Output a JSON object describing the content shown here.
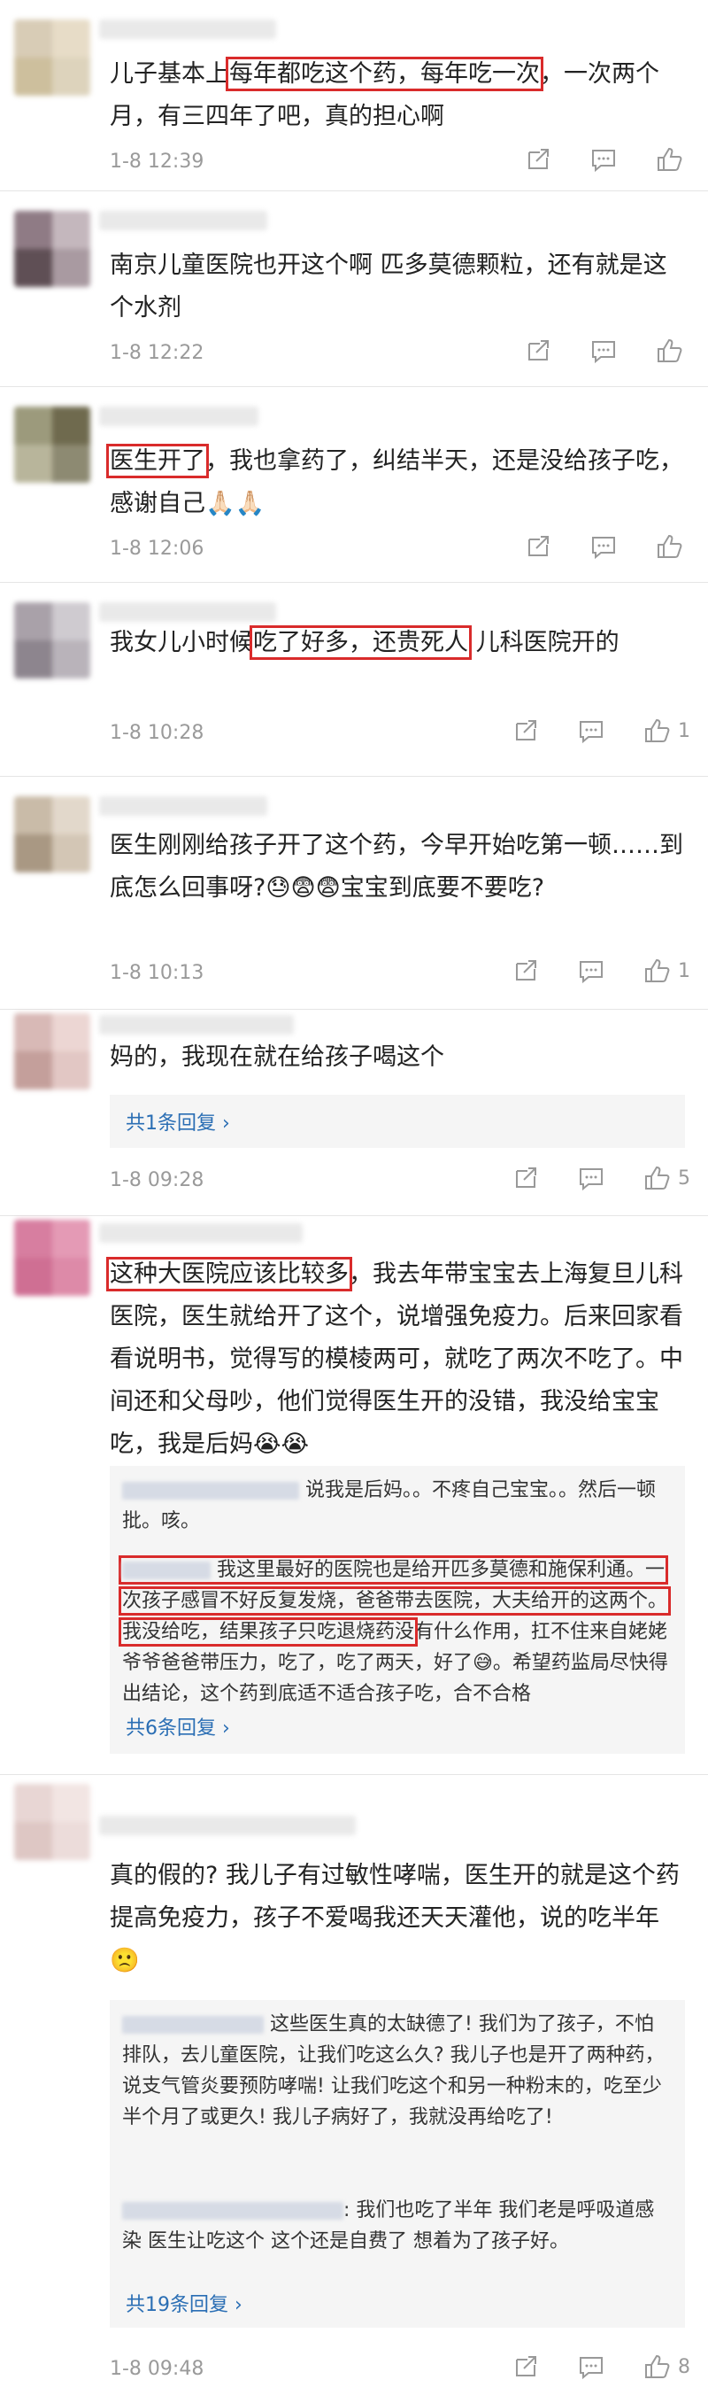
{
  "comments": [
    {
      "text_pre": "儿子基本上",
      "text_hl": "每年都吃这个药，每年吃一次",
      "text_post": "，一次两个月，有三四年了吧，真的担心啊",
      "time": "1-8 12:39",
      "likes": ""
    },
    {
      "text": "南京儿童医院也开这个啊 匹多莫德颗粒，还有就是这个水剂",
      "time": "1-8 12:22",
      "likes": ""
    },
    {
      "text_hl": "医生开了",
      "text_post": "，我也拿药了，纠结半天，还是没给孩子吃，感谢自己🙏🏻🙏🏻",
      "time": "1-8 12:06",
      "likes": ""
    },
    {
      "text_pre": "我女儿小时候",
      "text_hl": "吃了好多，还贵死人",
      "text_post": " 儿科医院开的",
      "time": "1-8 10:28",
      "likes": "1"
    },
    {
      "text": "医生刚刚给孩子开了这个药，今早开始吃第一顿……到底怎么回事呀?😓😨😨宝宝到底要不要吃?",
      "time": "1-8 10:13",
      "likes": "1"
    },
    {
      "text": "妈的，我现在就在给孩子喝这个",
      "reply_link": "共1条回复 ›",
      "time": "1-8 09:28",
      "likes": "5"
    },
    {
      "text_hl": "这种大医院应该比较多",
      "text_post": "，我去年带宝宝去上海复旦儿科医院，医生就给开了这个，说增强免疫力。后来回家看看说明书，觉得写的模棱两可，就吃了两次不吃了。中间还和父母吵，他们觉得医生开的没错，我没给宝宝吃，我是后妈😭😭",
      "replies": [
        {
          "text": "说我是后妈。。不疼自己宝宝。。然后一顿批。咳。"
        },
        {
          "text_hl": "我这里最好的医院也是给开匹多莫德和施保利通。一次孩子感冒不好反复发烧，爸爸带去医院，大夫给开的这两个。我没给吃，结果孩子只吃退烧药没",
          "text_post": "有什么作用，扛不住来自姥姥爷爷爸爸带压力，吃了，吃了两天，好了😅。希望药监局尽快得出结论，这个药到底适不适合孩子吃，合不合格"
        }
      ],
      "reply_link": "共6条回复 ›"
    },
    {
      "text": "真的假的? 我儿子有过敏性哮喘，医生开的就是这个药提高免疫力，孩子不爱喝我还天天灌他，说的吃半年🙁",
      "replies": [
        {
          "text": "这些医生真的太缺德了! 我们为了孩子，不怕排队，去儿童医院，让我们吃这么久? 我儿子也是开了两种药，说支气管炎要预防哮喘! 让我们吃这个和另一种粉末的，吃至少半个月了或更久! 我儿子病好了，我就没再给吃了!"
        },
        {
          "text": ": 我们也吃了半年 我们老是呼吸道感染 医生让吃这个 这个还是自费了 想着为了孩子好。"
        }
      ],
      "reply_link": "共19条回复 ›",
      "time": "1-8 09:48",
      "likes": "8"
    }
  ],
  "colors": {
    "highlight": "#d92b2b",
    "link": "#2a6eb4",
    "muted": "#9a9a9a"
  },
  "icons": [
    "share-icon",
    "comment-icon",
    "like-icon"
  ]
}
